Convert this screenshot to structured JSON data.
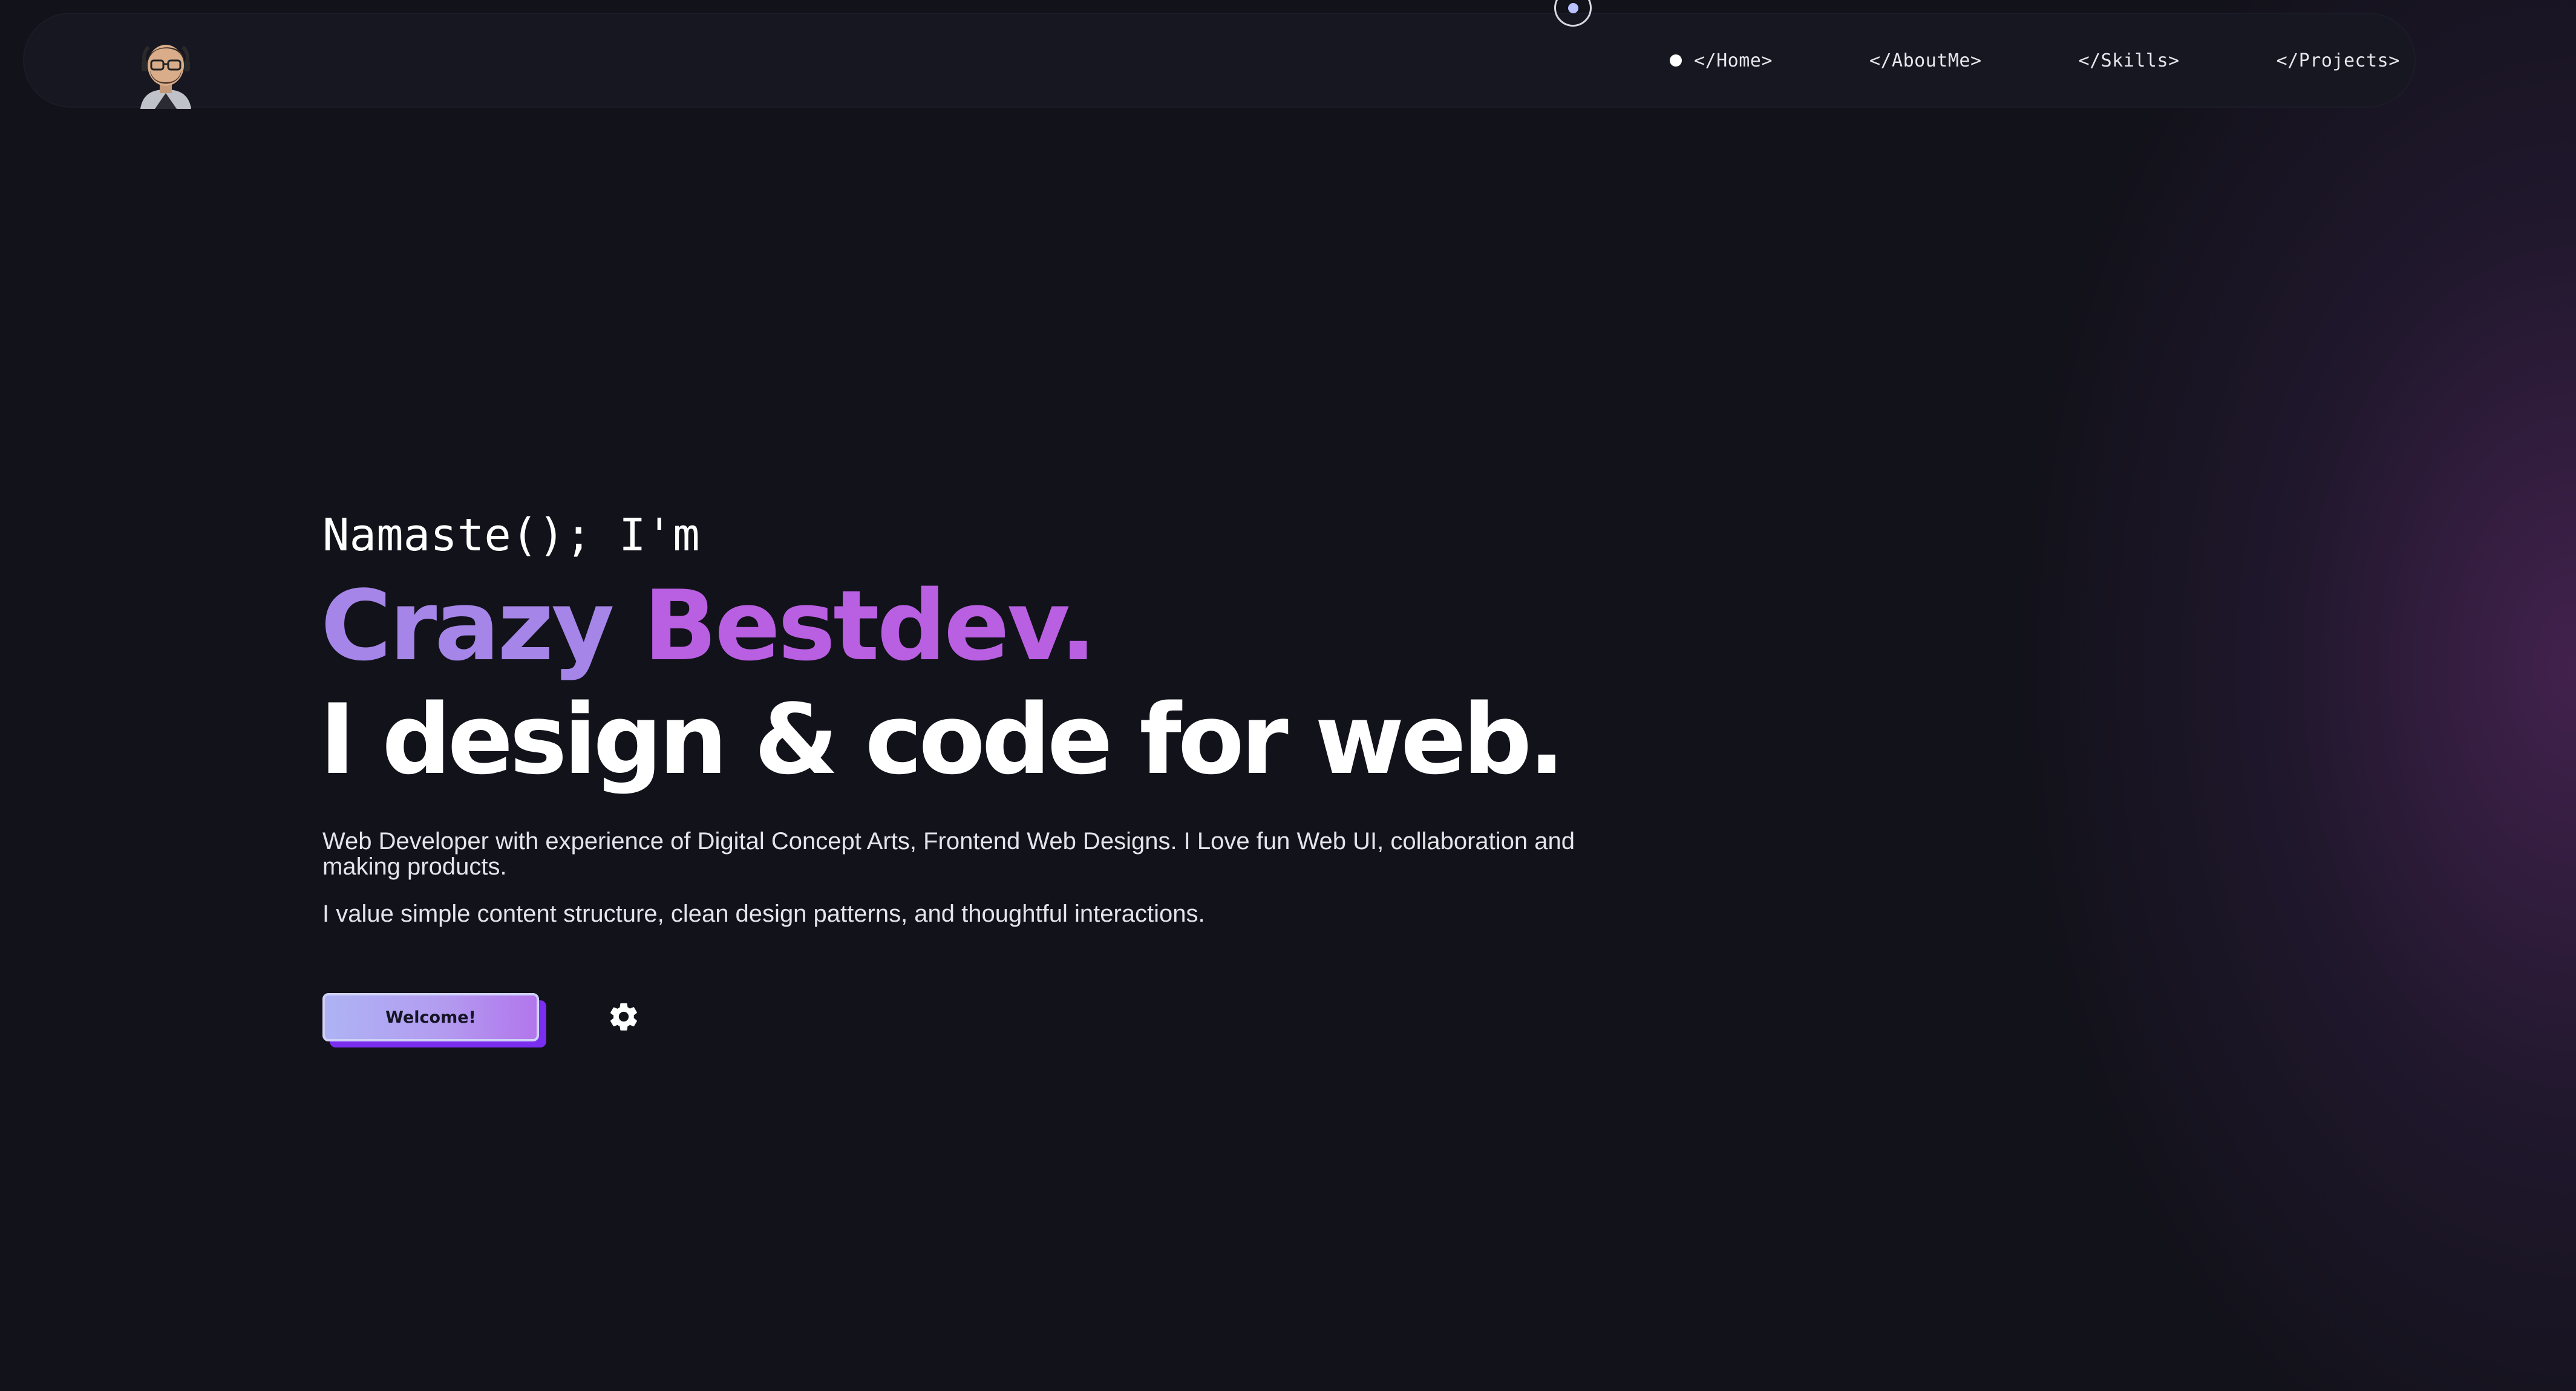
{
  "nav": {
    "items": [
      {
        "label": "</Home>",
        "active": true
      },
      {
        "label": "</AboutMe>",
        "active": false
      },
      {
        "label": "</Skills>",
        "active": false
      },
      {
        "label": "</Projects>",
        "active": false
      }
    ],
    "avatar_icon": "avatar-icon"
  },
  "hero": {
    "greeting": "Namaste(); I'm",
    "name_first": "Crazy",
    "name_last": "Bestdev.",
    "tagline": "I design & code for web.",
    "description_1": "Web Developer with experience of Digital Concept Arts, Frontend Web Designs. I Love fun Web UI, collaboration and making products.",
    "description_2": "I value simple content structure, clean design patterns, and thoughtful interactions.",
    "cta_label": "Welcome!",
    "settings_icon": "gear-icon"
  },
  "colors": {
    "background": "#12121a",
    "accent_purple": "#a585e8",
    "accent_magenta": "#b95fe2",
    "button_shadow": "#7a2ef0"
  }
}
